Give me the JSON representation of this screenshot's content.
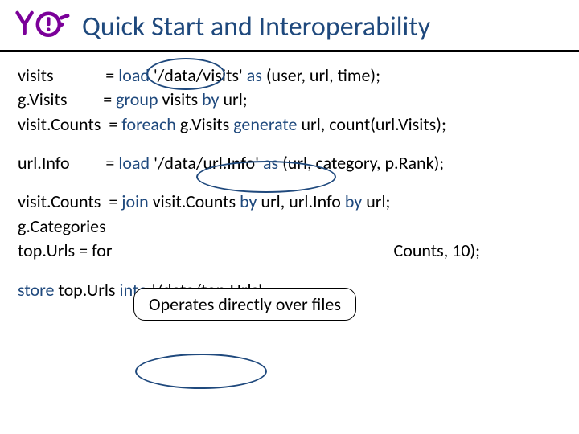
{
  "title": "Quick Start and Interoperability",
  "code": {
    "l1a": "visits             = ",
    "l1_load": "load",
    "l1b": " '/data/visits' ",
    "l1_as": "as",
    "l1c": " (user, url, time);",
    "l2a": "g.Visits         = ",
    "l2_group": "group",
    "l2b": " visits ",
    "l2_by": "by",
    "l2c": " url;",
    "l3a": "visit.Counts  = ",
    "l3_foreach": "foreach",
    "l3b": " g.Visits ",
    "l3_generate": "generate",
    "l3c": " url, count(url.Visits);",
    "l4a": "url.Info         = ",
    "l4_load": "load",
    "l4b": " '/data/url.Info' ",
    "l4_as": "as",
    "l4c": " (url, category, p.Rank);",
    "l5a": "visit.Counts  = ",
    "l5_join": "join",
    "l5b": " visit.Counts ",
    "l5_by1": "by",
    "l5c": " url, url.Info ",
    "l5_by2": "by",
    "l5d": " url;",
    "l6a": "g.Categories ",
    "l7a": "top.Urls = for",
    "l7tail": "Counts, 10);",
    "l8_store": "store",
    "l8a": " top.Urls ",
    "l8_into": "into",
    "l8b": " '/data/top.Urls';"
  },
  "callout": "Operates directly over files"
}
